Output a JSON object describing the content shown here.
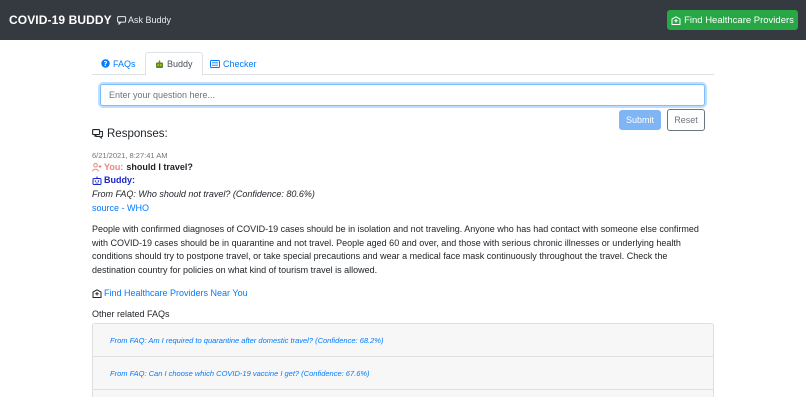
{
  "navbar": {
    "brand": "COVID-19 BUDDY",
    "ask_label": "Ask Buddy",
    "find_button": "Find Healthcare Providers"
  },
  "tabs": [
    {
      "label": "FAQs",
      "icon": "question-circle-icon",
      "active": false
    },
    {
      "label": "Buddy",
      "icon": "robot-icon",
      "active": true
    },
    {
      "label": "Checker",
      "icon": "card-list-icon",
      "active": false
    }
  ],
  "search": {
    "placeholder": "Enter your question here...",
    "value": ""
  },
  "actions": {
    "submit": "Submit",
    "reset": "Reset"
  },
  "responses": {
    "heading": "Responses:",
    "timestamp": "6/21/2021, 8:27:41 AM",
    "you_label": "You:",
    "question": "should I travel?",
    "buddy_label": "Buddy:",
    "from_faq": "From FAQ: Who should not travel? (Confidence: 80.6%)",
    "source": "source - WHO",
    "answer": "People with confirmed diagnoses of COVID-19 cases should be in isolation and not traveling. Anyone who has had contact with someone else confirmed with COVID-19 cases should be in quarantine and not travel. People aged 60 and over, and those with serious chronic illnesses or underlying health conditions should try to postpone travel, or take special precautions and wear a medical face mask continuously throughout the travel. Check the destination country for policies on what kind of tourism travel is allowed.",
    "near_link": "Find Healthcare Providers Near You",
    "other_heading": "Other related FAQs",
    "related": [
      "From FAQ: Am I required to quarantine after domestic travel? (Confidence: 68.2%)",
      "From FAQ: Can I choose which COVID-19 vaccine I get? (Confidence: 67.6%)"
    ]
  },
  "colors": {
    "navbar": "#343a40",
    "success": "#28a745",
    "primary": "#007bff",
    "you": "#e8877f",
    "buddy": "#1a25c8"
  }
}
